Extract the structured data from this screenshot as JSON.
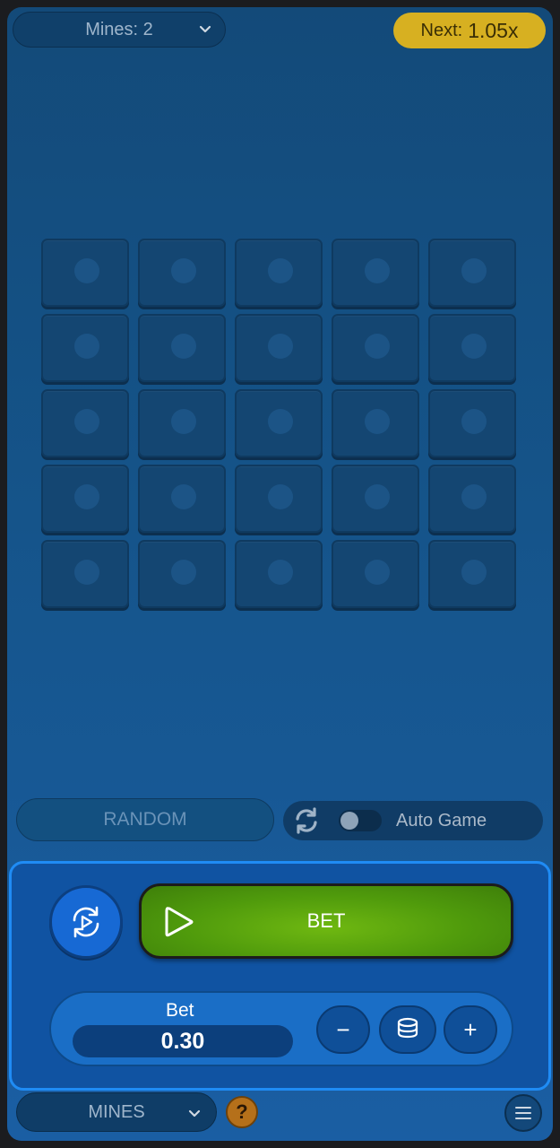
{
  "header": {
    "mines_select_label": "Mines: 2",
    "next_label": "Next:",
    "next_value": "1.05x"
  },
  "board": {
    "rows": 5,
    "columns": 5,
    "tile_state": "hidden"
  },
  "controls": {
    "random_label": "RANDOM",
    "auto_game_label": "Auto Game",
    "auto_game_enabled": false,
    "bet_button_label": "BET",
    "bet_title": "Bet",
    "bet_value": "0.30",
    "minus_label": "−",
    "plus_label": "+"
  },
  "footer": {
    "game_select_label": "MINES",
    "help_label": "?"
  },
  "icons": [
    "chevron-down-icon",
    "refresh-icon",
    "autoplay-icon",
    "play-icon",
    "coins-icon",
    "menu-icon"
  ],
  "colors": {
    "accent": "#1f8cf5",
    "bet_green": "#5aa80d",
    "next_gold": "#d7b021",
    "help_orange": "#b5701a"
  }
}
